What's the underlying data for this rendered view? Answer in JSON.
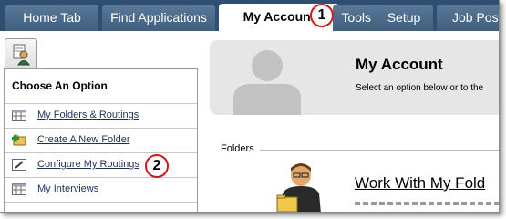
{
  "nav": {
    "tabs": [
      {
        "label": "Home Tab",
        "active": false
      },
      {
        "label": "Find Applications",
        "active": false
      },
      {
        "label": "My Account",
        "active": true
      },
      {
        "label": "Tools",
        "active": false
      },
      {
        "label": "Setup",
        "active": false
      },
      {
        "label": "Job Pos",
        "active": false
      }
    ]
  },
  "panel": {
    "heading": "Choose An Option",
    "items": [
      {
        "label": "My Folders & Routings",
        "icon": "table-icon"
      },
      {
        "label": "Create A New Folder",
        "icon": "add-folder-icon"
      },
      {
        "label": "Configure My Routings",
        "icon": "edit-icon"
      },
      {
        "label": "My Interviews",
        "icon": "table-icon"
      }
    ]
  },
  "account": {
    "title": "My Account",
    "subtitle": "Select an option below or to the"
  },
  "folders": {
    "section_label": "Folders",
    "work_title": "Work With My Fold"
  },
  "callouts": [
    "1",
    "2"
  ],
  "colors": {
    "nav_bg": "#2f4f72",
    "tab_bg": "#4d6b8c",
    "link": "#1f2f5a",
    "callout_border": "#d01818"
  }
}
